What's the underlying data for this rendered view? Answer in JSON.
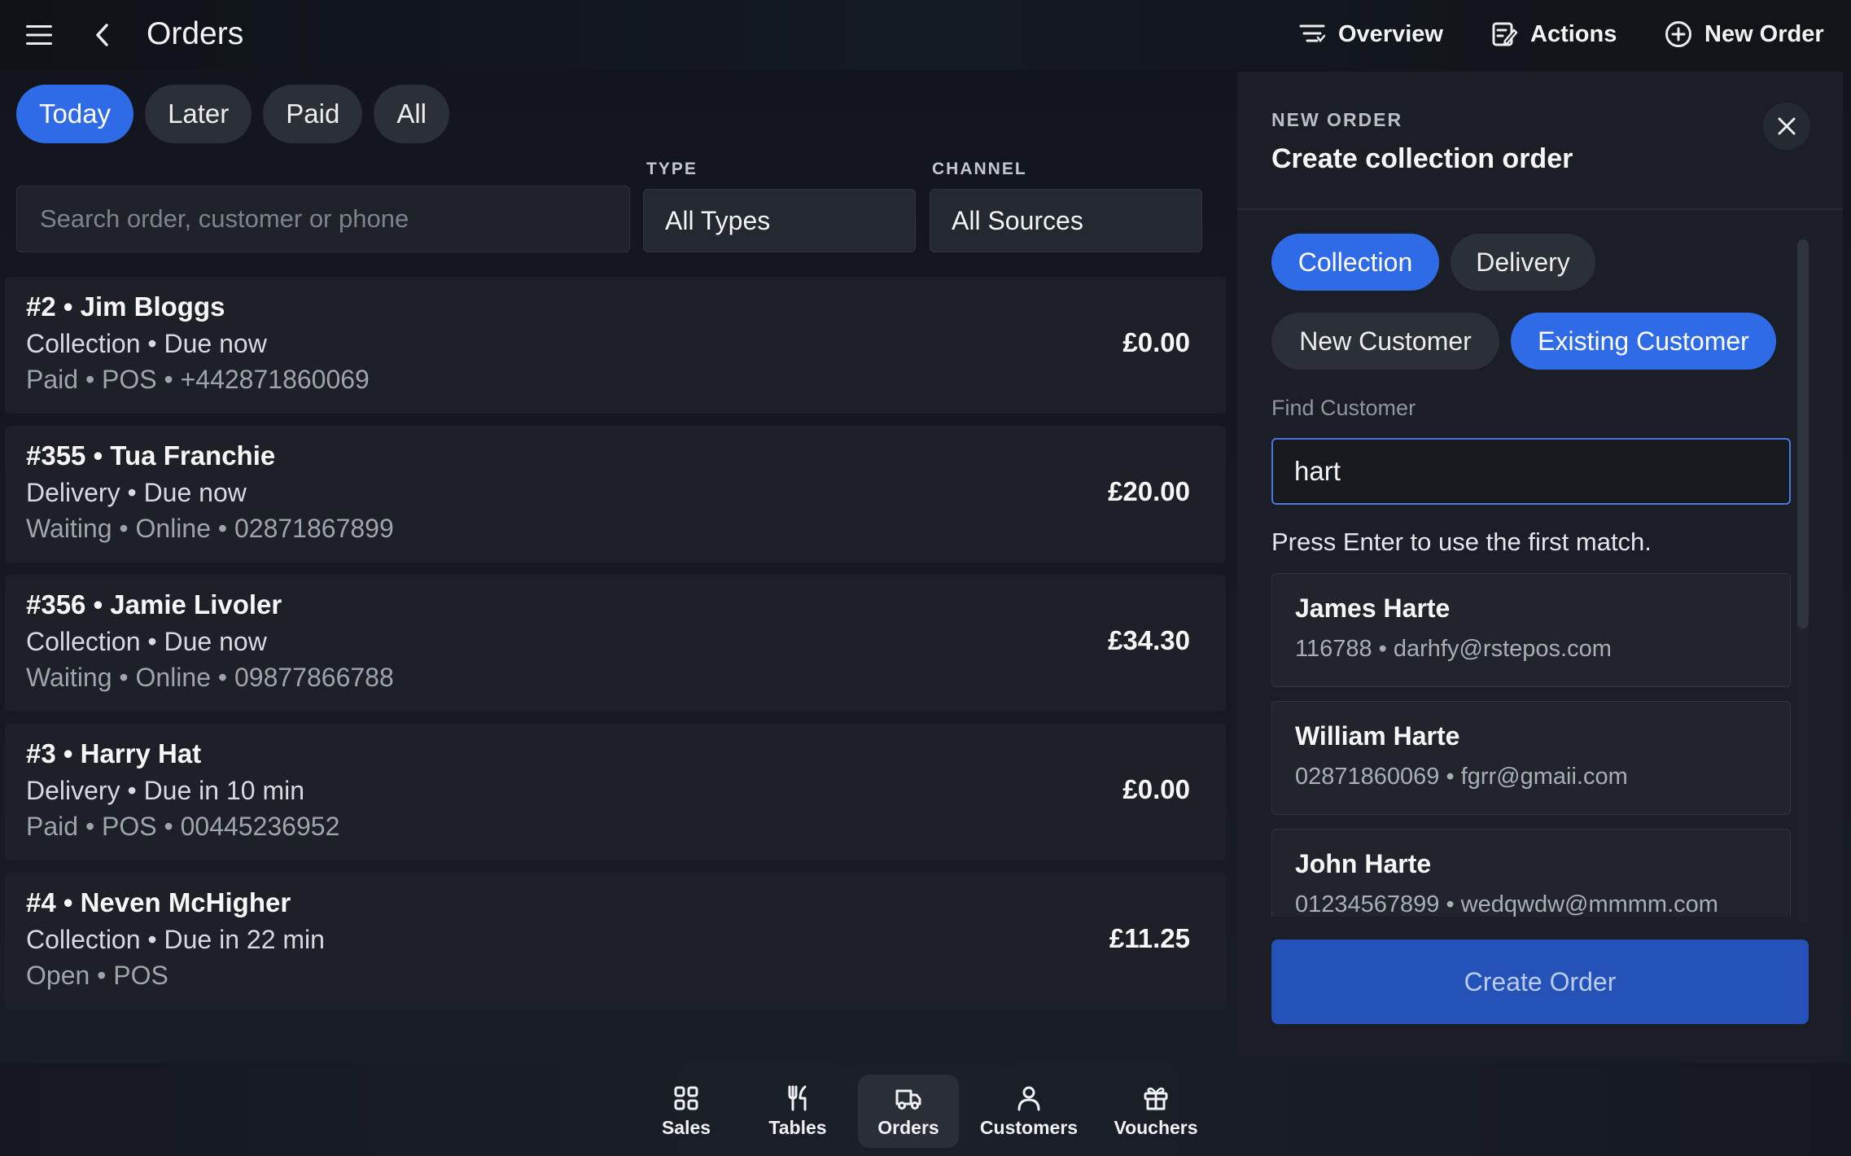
{
  "header": {
    "title": "Orders",
    "actions": [
      {
        "label": "Overview",
        "icon": "filter-lines-icon"
      },
      {
        "label": "Actions",
        "icon": "edit-note-icon"
      },
      {
        "label": "New Order",
        "icon": "plus-circle-icon"
      }
    ]
  },
  "filters": {
    "chips": [
      {
        "label": "Today",
        "active": true
      },
      {
        "label": "Later",
        "active": false
      },
      {
        "label": "Paid",
        "active": false
      },
      {
        "label": "All",
        "active": false
      }
    ],
    "search_placeholder": "Search order, customer or phone",
    "type_label": "TYPE",
    "type_value": "All Types",
    "channel_label": "CHANNEL",
    "channel_value": "All Sources"
  },
  "orders": [
    {
      "title": "#2 • Jim Bloggs",
      "line2": "Collection • Due now",
      "line3": "Paid • POS • +442871860069",
      "amount": "£0.00"
    },
    {
      "title": "#355 • Tua Franchie",
      "line2": "Delivery • Due now",
      "line3": "Waiting • Online • 02871867899",
      "amount": "£20.00"
    },
    {
      "title": "#356 • Jamie Livoler",
      "line2": "Collection • Due now",
      "line3": "Waiting • Online • 09877866788",
      "amount": "£34.30"
    },
    {
      "title": "#3 • Harry Hat",
      "line2": "Delivery • Due in 10 min",
      "line3": "Paid • POS • 00445236952",
      "amount": "£0.00"
    },
    {
      "title": "#4 • Neven McHigher",
      "line2": "Collection • Due in 22 min",
      "line3": "Open • POS",
      "amount": "£11.25"
    }
  ],
  "panel": {
    "eyebrow": "NEW ORDER",
    "title": "Create collection order",
    "order_type": [
      {
        "label": "Collection",
        "active": true
      },
      {
        "label": "Delivery",
        "active": false
      }
    ],
    "customer_type": [
      {
        "label": "New Customer",
        "active": false
      },
      {
        "label": "Existing Customer",
        "active": true
      }
    ],
    "find_label": "Find Customer",
    "find_value": "hart",
    "hint": "Press Enter to use the first match.",
    "results": [
      {
        "name": "James Harte",
        "meta": "116788 • darhfy@rstepos.com"
      },
      {
        "name": "William Harte",
        "meta": "02871860069 • fgrr@gmaii.com"
      },
      {
        "name": "John Harte",
        "meta": "01234567899 • wedqwdw@mmmm.com"
      }
    ],
    "create_label": "Create Order"
  },
  "nav": [
    {
      "label": "Sales",
      "icon": "grid-icon",
      "active": false
    },
    {
      "label": "Tables",
      "icon": "cutlery-icon",
      "active": false
    },
    {
      "label": "Orders",
      "icon": "delivery-truck-icon",
      "active": true
    },
    {
      "label": "Customers",
      "icon": "person-icon",
      "active": false
    },
    {
      "label": "Vouchers",
      "icon": "gift-icon",
      "active": false
    }
  ],
  "colors": {
    "accent": "#2f6be6",
    "background": "#14171c",
    "card": "#1d2026",
    "create_button": "#2452b6"
  }
}
